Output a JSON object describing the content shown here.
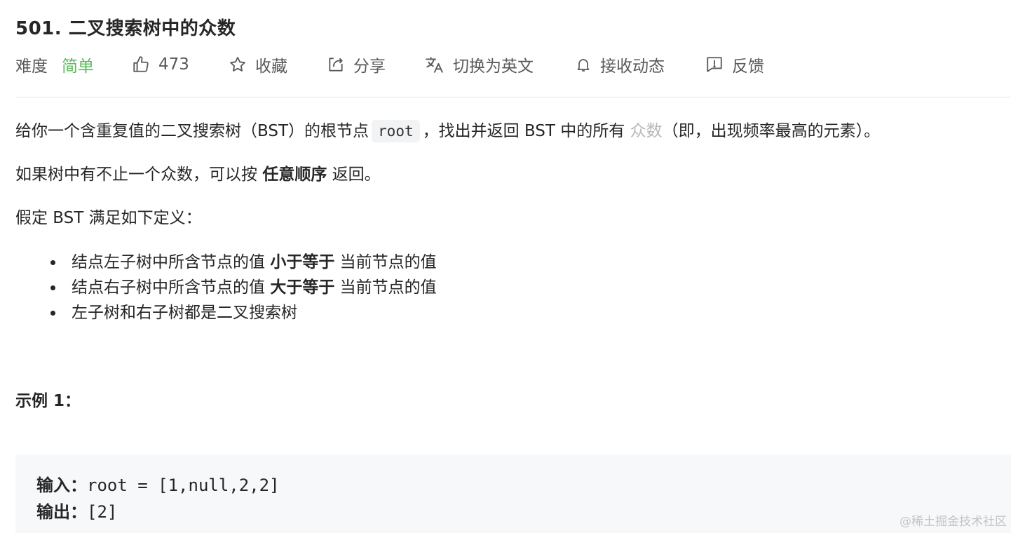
{
  "problem": {
    "title": "501. 二叉搜索树中的众数"
  },
  "toolbar": {
    "difficulty_label": "难度",
    "difficulty_value": "简单",
    "difficulty_color": "#5cb85c",
    "likes": "473",
    "favorite_label": "收藏",
    "share_label": "分享",
    "switch_lang_label": "切换为英文",
    "subscribe_label": "接收动态",
    "feedback_label": "反馈",
    "icons": [
      "thumbs-up-icon",
      "star-icon",
      "share-icon",
      "translate-icon",
      "bell-icon",
      "feedback-icon"
    ]
  },
  "description": {
    "p1_a": "给你一个含重复值的二叉搜索树（BST）的根节点",
    "p1_code": "root",
    "p1_b": "，找出并返回 BST 中的所有",
    "p1_link": "众数",
    "p1_c": "（即，出现频率最高的元素）。",
    "p2_a": "如果树中有不止一个众数，可以按",
    "p2_bold": "任意顺序",
    "p2_b": "返回。",
    "p3": "假定 BST 满足如下定义：",
    "bullets": [
      {
        "a": "结点左子树中所含节点的值",
        "bold": "小于等于",
        "b": "当前节点的值"
      },
      {
        "a": "结点右子树中所含节点的值",
        "bold": "大于等于",
        "b": "当前节点的值"
      },
      {
        "a": "左子树和右子树都是二叉搜索树",
        "bold": "",
        "b": ""
      }
    ]
  },
  "example": {
    "heading": "示例 1：",
    "input_label": "输入：",
    "input_value": "root = [1,null,2,2]",
    "output_label": "输出：",
    "output_value": "[2]"
  },
  "watermark": "@稀土掘金技术社区"
}
